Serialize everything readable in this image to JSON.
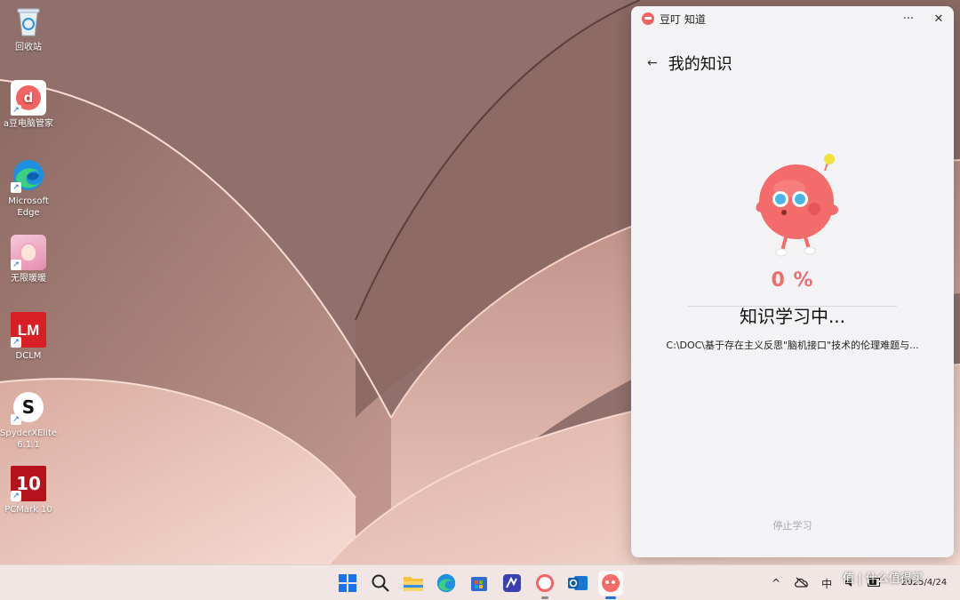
{
  "desktop": {
    "icons": [
      {
        "name": "recycle-bin",
        "label": "回收站"
      },
      {
        "name": "adou-pc-manager",
        "label": "a豆电脑管家"
      },
      {
        "name": "microsoft-edge",
        "label": "Microsoft Edge"
      },
      {
        "name": "infinity-nikki",
        "label": "无限暖暖"
      },
      {
        "name": "dclm",
        "label": "DCLM",
        "badge": "LM"
      },
      {
        "name": "spyderx-elite",
        "label": "SpyderXElite 6.1.1",
        "badge": "S"
      },
      {
        "name": "pcmark-10",
        "label": "PCMark 10",
        "badge": "10"
      }
    ]
  },
  "window": {
    "app_name": "豆叮 知道",
    "more_icon": "···",
    "close_icon": "✕",
    "back_icon": "←",
    "page_title": "我的知识",
    "progress_percent": "0 %",
    "progress_value": 0,
    "status_text": "知识学习中...",
    "file_path": "C:\\DOC\\基于存在主义反思\"脑机接口\"技术的伦理难题与...",
    "stop_button": "停止学习"
  },
  "taskbar": {
    "apps": [
      "start-icon",
      "search-icon",
      "file-explorer-icon",
      "edge-icon",
      "store-icon",
      "editor-icon",
      "adou-icon",
      "outlook-icon",
      "doubao-icon"
    ],
    "tray_chevron": "^",
    "ime": "中",
    "date_partial": "2025/4/24"
  },
  "watermark": "值 | 什么值得买",
  "colors": {
    "accent": "#ef6d6b",
    "window_bg": "#f3f3f6",
    "taskbar_bg": "#f1e6e4"
  }
}
